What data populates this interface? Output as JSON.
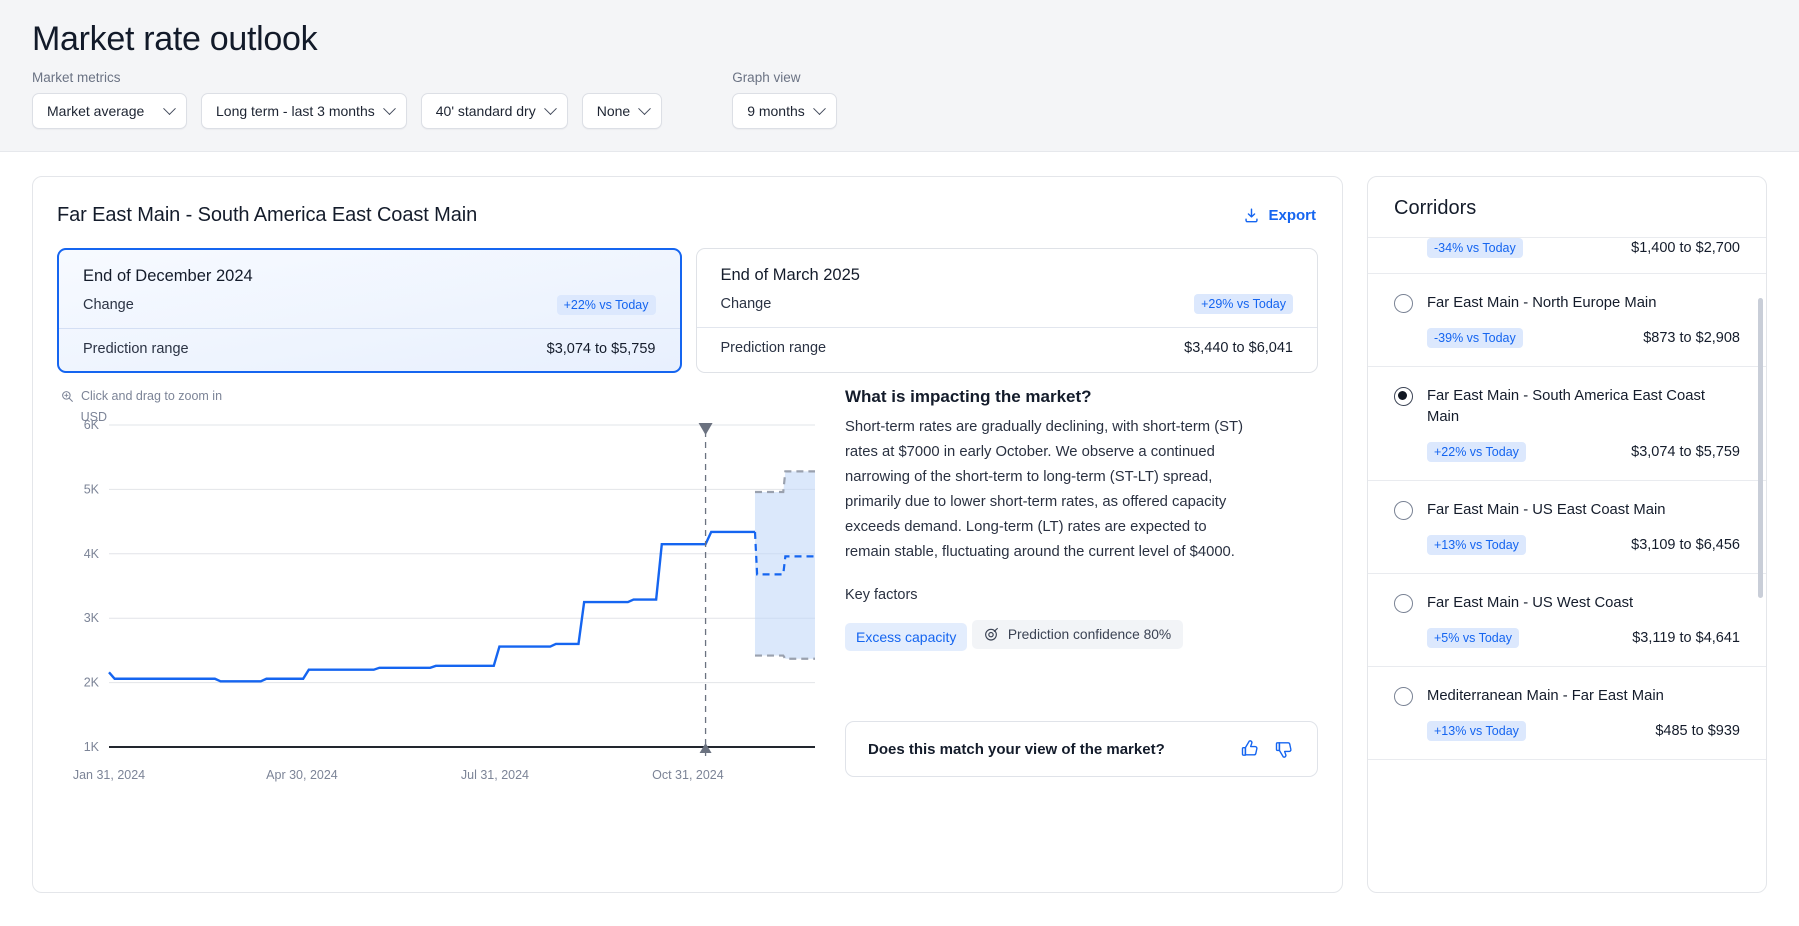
{
  "header": {
    "title": "Market rate outlook",
    "market_metrics_label": "Market metrics",
    "graph_view_label": "Graph view",
    "filters": [
      {
        "name": "market-metric",
        "value": "Market average"
      },
      {
        "name": "term",
        "value": "Long term - last 3 months"
      },
      {
        "name": "equipment",
        "value": "40' standard dry"
      },
      {
        "name": "extra",
        "value": "None"
      }
    ],
    "graph_view": {
      "name": "graph-range",
      "value": "9 months"
    }
  },
  "main": {
    "corridor_title": "Far East Main  -  South America East Coast Main",
    "export_label": "Export",
    "prediction_cards": [
      {
        "title": "End of December 2024",
        "change_label": "Change",
        "change_badge": "+22% vs Today",
        "range_label": "Prediction range",
        "range_value": "$3,074 to $5,759",
        "selected": true
      },
      {
        "title": "End of March 2025",
        "change_label": "Change",
        "change_badge": "+29% vs Today",
        "range_label": "Prediction range",
        "range_value": "$3,440 to $6,041",
        "selected": false
      }
    ],
    "zoom_hint": "Click and drag to zoom in",
    "insight": {
      "title": "What is impacting the market?",
      "body": "Short-term rates are gradually declining, with short-term (ST) rates at $7000 in early October. We observe a continued narrowing of the short-term to long-term (ST-LT) spread, primarily due to lower short-term rates, as offered capacity exceeds demand. Long-term (LT) rates are expected to remain stable, fluctuating around the current level of $4000.",
      "key_factors_label": "Key factors",
      "key_factors": [
        "Excess capacity"
      ],
      "confidence": "Prediction confidence 80%"
    },
    "feedback": {
      "question": "Does this match your view of the market?",
      "thumbs_up": "thumbs-up",
      "thumbs_down": "thumbs-down"
    }
  },
  "chart_data": {
    "type": "line",
    "title": "",
    "xlabel": "",
    "ylabel": "USD",
    "yunit": "USD",
    "ylim": [
      1000,
      6000
    ],
    "ytick_labels": [
      "1K",
      "2K",
      "3K",
      "4K",
      "5K",
      "6K"
    ],
    "ytick_values": [
      1000,
      2000,
      3000,
      4000,
      5000,
      6000
    ],
    "xtick_labels": [
      "Jan 31, 2024",
      "Apr 30, 2024",
      "Jul 31, 2024",
      "Oct 31, 2024"
    ],
    "grid": true,
    "legend_position": "none",
    "today_marker": {
      "label": "Today",
      "x_fraction": 0.845
    },
    "series": [
      {
        "name": "Historical market rate",
        "style": "step-solid",
        "color": "#1565f0",
        "points": [
          [
            0.0,
            2160
          ],
          [
            0.008,
            2060
          ],
          [
            0.15,
            2060
          ],
          [
            0.158,
            2020
          ],
          [
            0.215,
            2020
          ],
          [
            0.223,
            2060
          ],
          [
            0.275,
            2060
          ],
          [
            0.283,
            2200
          ],
          [
            0.375,
            2200
          ],
          [
            0.383,
            2230
          ],
          [
            0.455,
            2230
          ],
          [
            0.463,
            2260
          ],
          [
            0.545,
            2260
          ],
          [
            0.553,
            2560
          ],
          [
            0.625,
            2560
          ],
          [
            0.633,
            2600
          ],
          [
            0.665,
            2600
          ],
          [
            0.673,
            3250
          ],
          [
            0.735,
            3250
          ],
          [
            0.743,
            3290
          ],
          [
            0.775,
            3290
          ],
          [
            0.783,
            4150
          ],
          [
            0.845,
            4150
          ],
          [
            0.853,
            4340
          ],
          [
            0.915,
            4340
          ]
        ]
      },
      {
        "name": "Predicted rate",
        "style": "step-dashed",
        "color": "#1565f0",
        "points": [
          [
            0.915,
            4340
          ],
          [
            0.918,
            3680
          ],
          [
            0.955,
            3680
          ],
          [
            0.958,
            3960
          ],
          [
            1.0,
            3960
          ]
        ]
      },
      {
        "name": "Prediction upper bound",
        "style": "step-dashed",
        "color": "#9aa1ae",
        "points": [
          [
            0.915,
            4960
          ],
          [
            0.955,
            4960
          ],
          [
            0.958,
            5280
          ],
          [
            1.0,
            5280
          ]
        ]
      },
      {
        "name": "Prediction lower bound",
        "style": "step-dashed",
        "color": "#9aa1ae",
        "points": [
          [
            0.915,
            2420
          ],
          [
            0.955,
            2420
          ],
          [
            0.958,
            2370
          ],
          [
            1.0,
            2370
          ]
        ]
      }
    ],
    "band": {
      "name": "Prediction range band",
      "fill": "#bed5f7",
      "opacity": 0.55
    }
  },
  "sidebar": {
    "title": "Corridors",
    "items": [
      {
        "name": "",
        "badge": "-34% vs Today",
        "range": "$1,400 to $2,700",
        "selected": false,
        "clipped": true
      },
      {
        "name": "Far East Main - North Europe Main",
        "badge": "-39% vs Today",
        "range": "$873 to $2,908",
        "selected": false,
        "clipped": false
      },
      {
        "name": "Far East Main - South America East Coast Main",
        "badge": "+22% vs Today",
        "range": "$3,074 to $5,759",
        "selected": true,
        "clipped": false
      },
      {
        "name": "Far East Main - US East Coast Main",
        "badge": "+13% vs Today",
        "range": "$3,109 to $6,456",
        "selected": false,
        "clipped": false
      },
      {
        "name": "Far East Main - US West Coast",
        "badge": "+5% vs Today",
        "range": "$3,119 to $4,641",
        "selected": false,
        "clipped": false
      },
      {
        "name": "Mediterranean Main - Far East Main",
        "badge": "+13% vs Today",
        "range": "$485 to $939",
        "selected": false,
        "clipped": false
      }
    ]
  },
  "colors": {
    "accent": "#1565f0",
    "badge_bg": "#dce8fd",
    "page_bg": "#f4f5f7",
    "band_fill": "#bed5f7",
    "bound_line": "#9aa1ae"
  }
}
